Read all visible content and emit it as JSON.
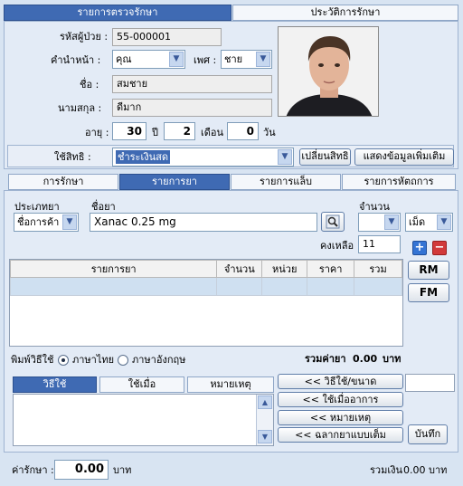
{
  "top_tabs": [
    "รายการตรวจรักษา",
    "ประวัติการรักษา"
  ],
  "patient": {
    "hn_label": "รหัสผู้ป่วย :",
    "hn_value": "55-000001",
    "prefix_label": "คำนำหน้า :",
    "prefix_value": "คุณ",
    "sex_label": "เพศ :",
    "sex_value": "ชาย",
    "firstname_label": "ชื่อ :",
    "firstname_value": "สมชาย",
    "lastname_label": "นามสกุล :",
    "lastname_value": "ดีมาก",
    "age_label": "อายุ :",
    "age_years": "30",
    "years_unit": "ปี",
    "age_months": "2",
    "months_unit": "เดือน",
    "age_days": "0",
    "days_unit": "วัน"
  },
  "rights": {
    "label": "ใช้สิทธิ :",
    "value": "ชำระเงินสด",
    "change_button": "เปลี่ยนสิทธิ",
    "more_button": "แสดงข้อมูลเพิ่มเติม"
  },
  "section_tabs": [
    "การรักษา",
    "รายการยา",
    "รายการแล็บ",
    "รายการหัตถการ"
  ],
  "drug_form": {
    "type_label": "ประเภทยา",
    "type_value": "ชื่อการค้า",
    "name_label": "ชื่อยา",
    "name_value": "Xanac 0.25 mg",
    "qty_label": "จำนวน",
    "qty_value": "",
    "unit_value": "เม็ด",
    "remaining_label": "คงเหลือ",
    "remaining_value": "11"
  },
  "side_buttons": {
    "add": "+",
    "remove": "−",
    "rm": "RM",
    "fm": "FM"
  },
  "drug_table": {
    "columns": [
      "รายการยา",
      "จำนวน",
      "หน่วย",
      "ราคา",
      "รวม"
    ]
  },
  "print_language": {
    "label": "พิมพ์วิธีใช้",
    "thai": "ภาษาไทย",
    "english": "ภาษาอังกฤษ",
    "total_label": "รวมค่ายา",
    "total_value": "0.00",
    "currency": "บาท"
  },
  "usage_tabs": [
    "วิธีใช้",
    "ใช้เมื่อ",
    "หมายเหตุ"
  ],
  "usage_buttons": [
    "<<      วิธีใช้/ขนาด",
    "<<      ใช้เมื่ออาการ",
    "<<      หมายเหตุ",
    "<<      ฉลากยาแบบเต็ม"
  ],
  "save_button": "บันทึก",
  "footer": {
    "fee_label": "ค่ารักษา :",
    "fee_value": "0.00",
    "fee_currency": "บาท",
    "grand_total_label": "รวมเงิน",
    "grand_total_value": "0.00",
    "grand_total_currency": "บาท"
  },
  "colors": {
    "accent": "#3f6ab3",
    "panel": "#e3ebf6",
    "background": "#d8e4f2",
    "remove": "#d23a3a"
  }
}
